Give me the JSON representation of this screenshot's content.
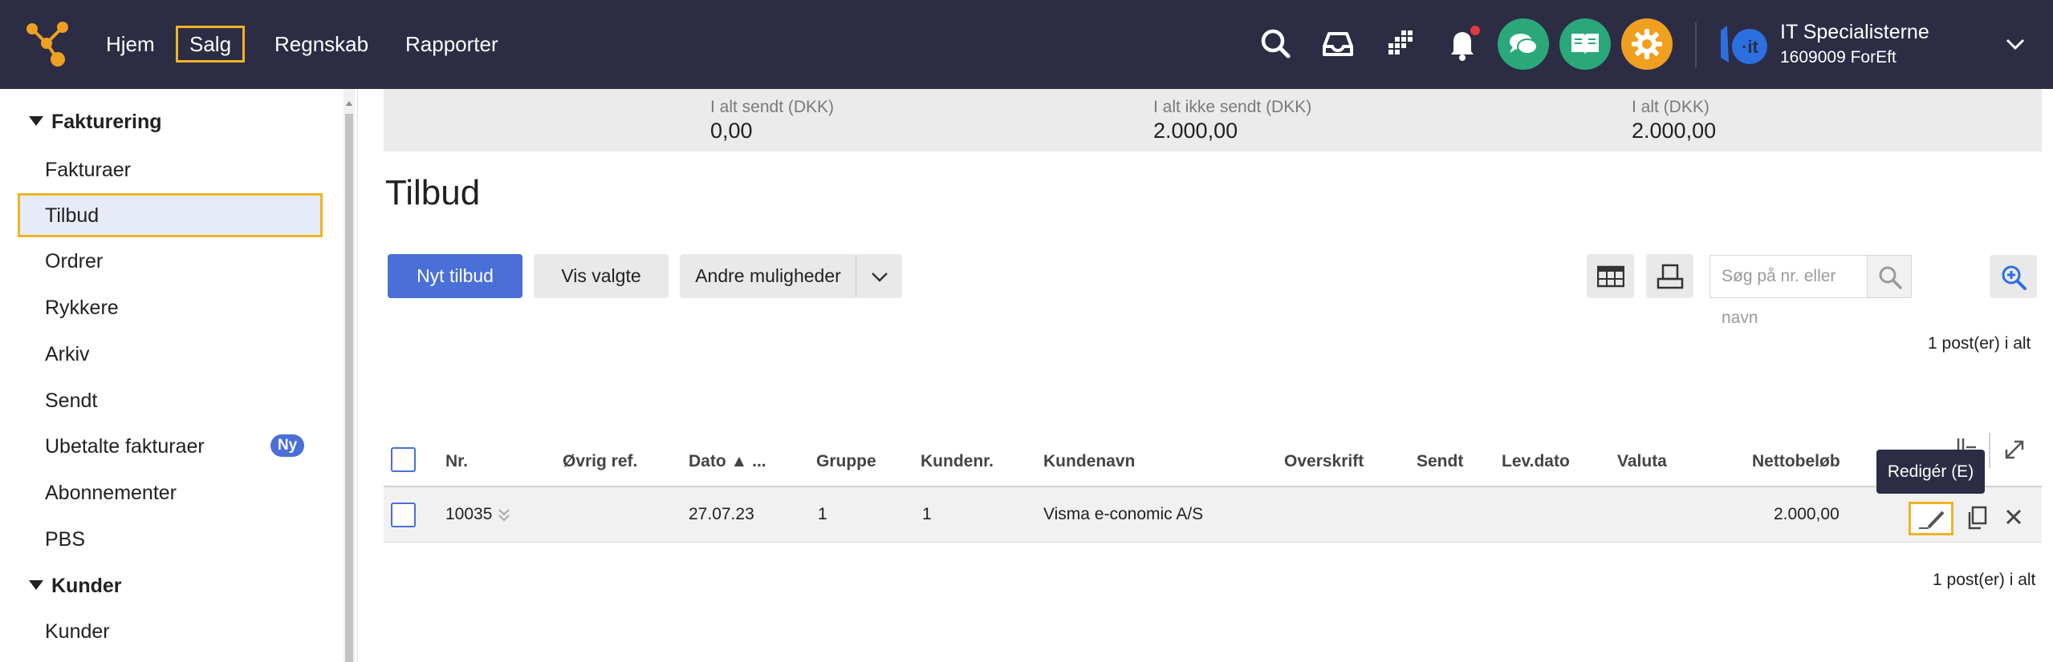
{
  "nav": {
    "items": [
      {
        "label": "Hjem",
        "active": false
      },
      {
        "label": "Salg",
        "active": true
      },
      {
        "label": "Regnskab",
        "active": false
      },
      {
        "label": "Rapporter",
        "active": false
      }
    ]
  },
  "topbar": {
    "icons": [
      "search-icon",
      "inbox-icon",
      "apps-grid-icon",
      "bell-icon",
      "chat-icon",
      "book-icon",
      "settings-icon"
    ],
    "notification_dot": true,
    "company": {
      "name": "IT Specialisterne",
      "id": "1609009 ForEft"
    },
    "colors": {
      "bar": "#2c2c45",
      "chat": "#2aa87a",
      "book": "#2aa87a",
      "settings": "#f0a020",
      "highlight": "#f0b323"
    }
  },
  "sidebar": {
    "sections": [
      {
        "title": "Fakturering",
        "items": [
          {
            "label": "Fakturaer"
          },
          {
            "label": "Tilbud",
            "selected": true
          },
          {
            "label": "Ordrer"
          },
          {
            "label": "Rykkere"
          },
          {
            "label": "Arkiv"
          },
          {
            "label": "Sendt"
          },
          {
            "label": "Ubetalte fakturaer",
            "badge": "Ny"
          },
          {
            "label": "Abonnementer"
          },
          {
            "label": "PBS"
          }
        ]
      },
      {
        "title": "Kunder",
        "items": [
          {
            "label": "Kunder"
          }
        ]
      }
    ]
  },
  "summary": [
    {
      "label": "I alt sendt (DKK)",
      "value": "0,00"
    },
    {
      "label": "I alt ikke sendt (DKK)",
      "value": "2.000,00"
    },
    {
      "label": "I alt (DKK)",
      "value": "2.000,00"
    }
  ],
  "page": {
    "title": "Tilbud",
    "buttons": {
      "new": "Nyt tilbud",
      "show_selected": "Vis valgte",
      "other_options": "Andre muligheder"
    },
    "search_placeholder": "Søg på nr. eller navn",
    "posts_count_top": "1 post(er) i alt",
    "posts_count_bottom": "1 post(er) i alt"
  },
  "table": {
    "columns": [
      "Nr.",
      "Øvrig ref.",
      "Dato ▲ ...",
      "Gruppe",
      "Kundenr.",
      "Kundenavn",
      "Overskrift",
      "Sendt",
      "Lev.dato",
      "Valuta",
      "Nettobeløb"
    ],
    "rows": [
      {
        "nr": "10035",
        "ovrig_ref": "",
        "dato": "27.07.23",
        "gruppe": "1",
        "kundenr": "1",
        "kundenavn": "Visma e-conomic A/S",
        "overskrift": "",
        "sendt": "",
        "levdato": "",
        "valuta": "",
        "nettobelob": "2.000,00"
      }
    ],
    "tooltip": "Redigér (E)"
  }
}
